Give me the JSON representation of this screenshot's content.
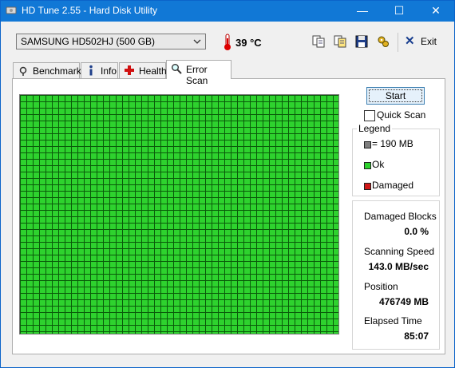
{
  "window": {
    "title": "HD Tune 2.55 - Hard Disk Utility",
    "controls": {
      "minimize": "—",
      "maximize": "☐",
      "close": "✕"
    }
  },
  "toolbar": {
    "drive": "SAMSUNG HD502HJ (500 GB)",
    "temperature": "39 °C",
    "icons": [
      "copy-icon",
      "copy-all-icon",
      "save-icon",
      "options-icon"
    ],
    "exit_label": "Exit"
  },
  "tabs": [
    {
      "label": "Benchmark",
      "icon": "benchmark-icon",
      "active": false
    },
    {
      "label": "Info",
      "icon": "info-icon",
      "active": false
    },
    {
      "label": "Health",
      "icon": "health-icon",
      "active": false
    },
    {
      "label": "Error Scan",
      "icon": "error-scan-icon",
      "active": true
    }
  ],
  "scan": {
    "start_label": "Start",
    "quick_scan_label": "Quick Scan",
    "quick_scan_checked": false,
    "block_status": "all ok"
  },
  "legend": {
    "title": "Legend",
    "block_size": "= 190 MB",
    "ok": "Ok",
    "damaged": "Damaged",
    "colors": {
      "block": "#7f7f7f",
      "ok": "#2ed22e",
      "damaged": "#d01818"
    }
  },
  "stats": {
    "damaged_blocks_label": "Damaged Blocks",
    "damaged_blocks_value": "0.0 %",
    "speed_label": "Scanning Speed",
    "speed_value": "143.0 MB/sec",
    "position_label": "Position",
    "position_value": "476749 MB",
    "elapsed_label": "Elapsed Time",
    "elapsed_value": "85:07"
  }
}
